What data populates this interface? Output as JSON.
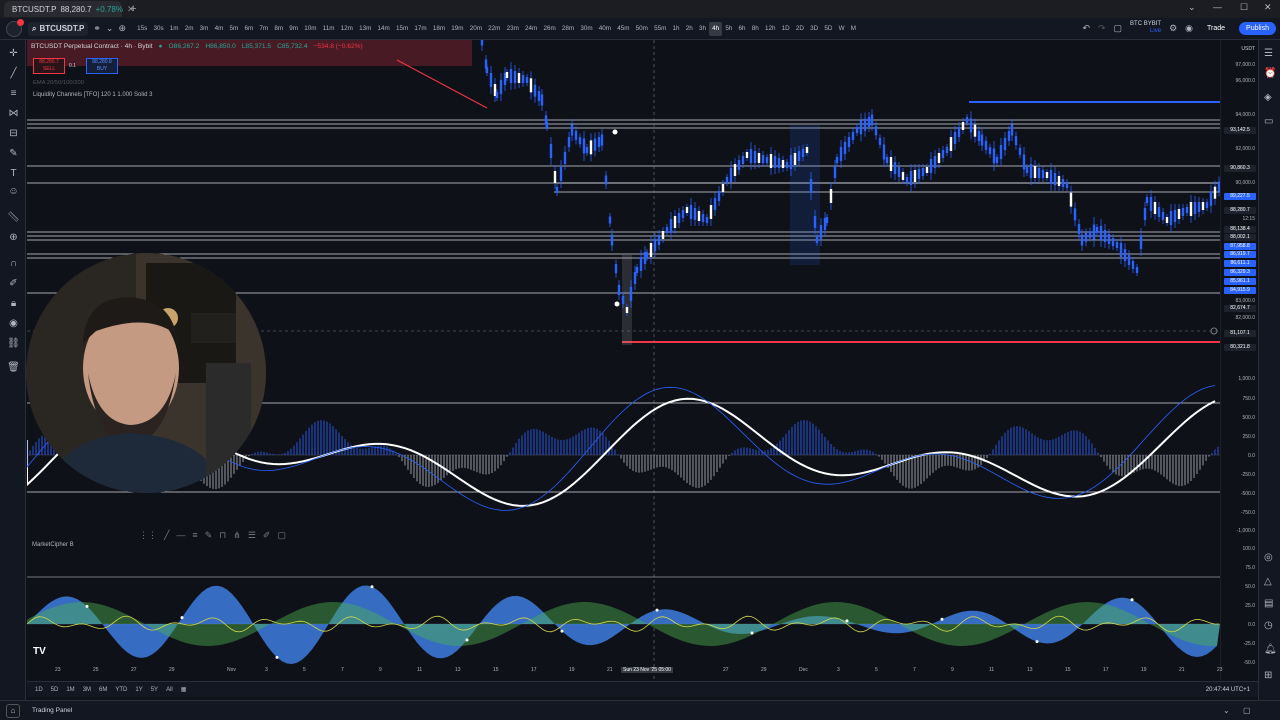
{
  "browser": {
    "tab_title": "BTCUSDT.P",
    "tab_price": "88,280.7",
    "tab_change": "+0.78%"
  },
  "toolbar": {
    "symbol": "BTCUSDT.P",
    "intervals": [
      "15s",
      "30s",
      "1m",
      "2m",
      "3m",
      "4m",
      "5m",
      "6m",
      "7m",
      "8m",
      "9m",
      "10m",
      "11m",
      "12m",
      "13m",
      "14m",
      "15m",
      "17m",
      "18m",
      "19m",
      "20m",
      "22m",
      "23m",
      "24m",
      "26m",
      "28m",
      "30m",
      "40m",
      "45m",
      "50m",
      "55m",
      "1h",
      "2h",
      "3h",
      "4h",
      "5h",
      "6h",
      "8h",
      "12h",
      "1D",
      "2D",
      "3D",
      "5D",
      "W",
      "M"
    ],
    "active_interval": "4h",
    "broker_line1": "BTC BYBIT",
    "broker_line2": "Live",
    "trade_label": "Trade",
    "publish_label": "Publish"
  },
  "legend": {
    "title": "BTCUSDT Perpetual Contract · 4h · Bybit",
    "open": "O86,267.2",
    "high": "H86,850.0",
    "low": "L85,371.5",
    "close": "C85,732.4",
    "change": "−534.8 (−0.62%)",
    "sell_price": "88,280.7",
    "sell_label": "SELL",
    "spread": "0.1",
    "buy_price": "88,280.8",
    "buy_label": "BUY",
    "ema_label": "EMA 20/50/100/200",
    "indicator_label": "Liquidity Channels [TFO] 120 1 1.000 Solid 3"
  },
  "price_axis": {
    "currency": "USDT",
    "labels": [
      "97,000.0",
      "96,000.0",
      "94,000.0",
      "93,142.5",
      "92,000.0",
      "90,860.3",
      "90,000.0",
      "89,227.5",
      "88,280.7",
      "12:15",
      "88,138.4",
      "88,002.1",
      "87,958.8",
      "86,919.7",
      "86,611.1",
      "86,329.3",
      "85,961.1",
      "84,915.9",
      "83,000.0",
      "82,674.7",
      "82,000.0",
      "81,107.1",
      "80,321.8"
    ],
    "osc_labels": [
      "1,000.0",
      "750.0",
      "500.0",
      "250.0",
      "0.0",
      "-250.0",
      "-500.0",
      "-750.0",
      "-1,000.0"
    ],
    "mcb_labels": [
      "100.0",
      "75.0",
      "50.0",
      "25.0",
      "0.0",
      "-25.0",
      "-50.0"
    ]
  },
  "indicators": {
    "mcb_label": "MarketCipher B"
  },
  "time_axis": {
    "labels": [
      "23",
      "25",
      "27",
      "29",
      "Nov",
      "3",
      "5",
      "7",
      "9",
      "11",
      "13",
      "15",
      "17",
      "19",
      "21",
      "23",
      "25",
      "27",
      "29",
      "Dec",
      "3",
      "5",
      "7",
      "9",
      "11",
      "13",
      "15",
      "17",
      "19",
      "21",
      "23"
    ],
    "cursor_label": "Sun 23 Nov '25",
    "cursor_time": "05:00"
  },
  "bottom_bar": {
    "ranges": [
      "1D",
      "5D",
      "1M",
      "3M",
      "6M",
      "YTD",
      "1Y",
      "5Y",
      "All"
    ],
    "clock": "20:47:44 UTC+1"
  },
  "trading_panel": {
    "label": "Trading Panel"
  },
  "colors": {
    "accent": "#2962ff",
    "candle": "#2962ff",
    "down": "#f23645",
    "up": "#26a69a",
    "wave": "#ffffff",
    "mcb_blue": "#3d7ee0",
    "mcb_green": "#4caf50",
    "mcb_yellow": "#d4d84a"
  },
  "icons": [
    "crosshair-icon",
    "trendline-icon",
    "fib-icon",
    "pattern-icon",
    "projection-icon",
    "brush-icon",
    "text-icon",
    "emoji-icon",
    "ruler-icon",
    "zoom-icon",
    "magnet-icon",
    "lock-icon",
    "eye-icon",
    "trash-icon"
  ]
}
